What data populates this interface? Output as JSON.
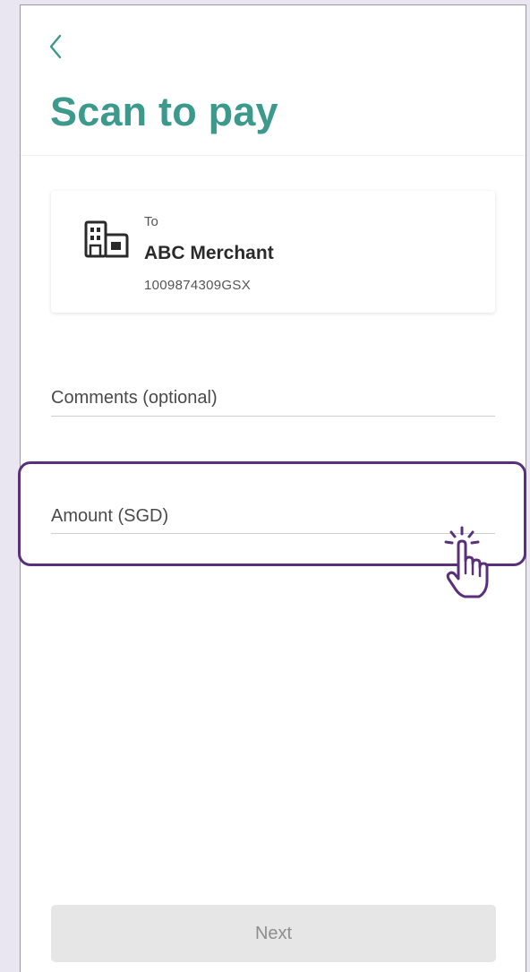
{
  "header": {
    "back_icon": "chevron-left-icon",
    "title": "Scan to pay"
  },
  "merchant": {
    "icon": "building-icon",
    "to_label": "To",
    "name": "ABC Merchant",
    "id": "1009874309GSX"
  },
  "form": {
    "comments_label": "Comments (optional)",
    "amount_label": "Amount (SGD)"
  },
  "overlay": {
    "cursor_icon": "tap-hand-icon"
  },
  "footer": {
    "next_label": "Next"
  },
  "colors": {
    "accent": "#3b9a8c",
    "highlight": "#59307a",
    "background": "#e9e6f1",
    "button_disabled": "#e6e6e6"
  }
}
